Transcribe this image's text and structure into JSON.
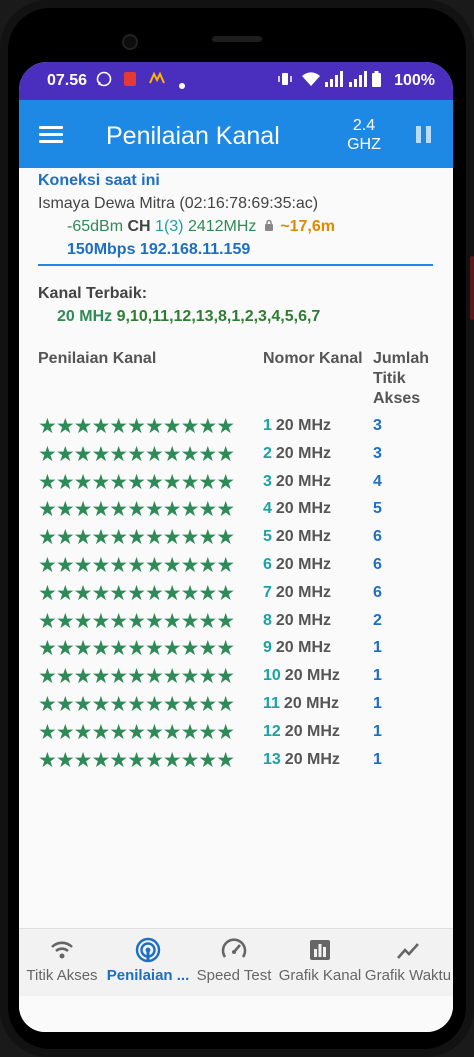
{
  "status_bar": {
    "time": "07.56",
    "battery": "100%"
  },
  "toolbar": {
    "title": "Penilaian Kanal",
    "band_line1": "2.4",
    "band_line2": "GHZ"
  },
  "connection": {
    "header": "Koneksi saat ini",
    "ssid": "Ismaya Dewa Mitra (02:16:78:69:35:ac)",
    "rssi": "-65dBm",
    "ch_label": "CH",
    "channel": "1(3)",
    "frequency": "2412MHz",
    "distance": "~17,6m",
    "speed_ip": "150Mbps 192.168.11.159"
  },
  "best": {
    "label": "Kanal Terbaik:",
    "width": "20 MHz",
    "channels": "9,10,11,12,13,8,1,2,3,4,5,6,7"
  },
  "table": {
    "col_rating": "Penilaian Kanal",
    "col_channel": "Nomor Kanal",
    "col_count": "Jumlah Titik Akses",
    "rows": [
      {
        "stars": "★★★★★★★★★★★",
        "channel": "1",
        "width": "20 MHz",
        "count": "3"
      },
      {
        "stars": "★★★★★★★★★★★",
        "channel": "2",
        "width": "20 MHz",
        "count": "3"
      },
      {
        "stars": "★★★★★★★★★★★",
        "channel": "3",
        "width": "20 MHz",
        "count": "4"
      },
      {
        "stars": "★★★★★★★★★★★",
        "channel": "4",
        "width": "20 MHz",
        "count": "5"
      },
      {
        "stars": "★★★★★★★★★★★",
        "channel": "5",
        "width": "20 MHz",
        "count": "6"
      },
      {
        "stars": "★★★★★★★★★★★",
        "channel": "6",
        "width": "20 MHz",
        "count": "6"
      },
      {
        "stars": "★★★★★★★★★★★",
        "channel": "7",
        "width": "20 MHz",
        "count": "6"
      },
      {
        "stars": "★★★★★★★★★★★",
        "channel": "8",
        "width": "20 MHz",
        "count": "2"
      },
      {
        "stars": "★★★★★★★★★★★",
        "channel": "9",
        "width": "20 MHz",
        "count": "1"
      },
      {
        "stars": "★★★★★★★★★★★",
        "channel": "10",
        "width": "20 MHz",
        "count": "1"
      },
      {
        "stars": "★★★★★★★★★★★",
        "channel": "11",
        "width": "20 MHz",
        "count": "1"
      },
      {
        "stars": "★★★★★★★★★★★",
        "channel": "12",
        "width": "20 MHz",
        "count": "1"
      },
      {
        "stars": "★★★★★★★★★★★",
        "channel": "13",
        "width": "20 MHz",
        "count": "1"
      }
    ]
  },
  "bottom_nav": [
    {
      "label": "Titik Akses",
      "icon": "wifi-icon"
    },
    {
      "label": "Penilaian ...",
      "icon": "radar-icon"
    },
    {
      "label": "Speed Test",
      "icon": "speedometer-icon"
    },
    {
      "label": "Grafik Kanal",
      "icon": "bar-chart-icon"
    },
    {
      "label": "Grafik Waktu",
      "icon": "line-chart-icon"
    }
  ],
  "colors": {
    "accent": "#1e88e5",
    "status_bar": "#4a2fbf",
    "star": "#2e8b57",
    "channel": "#1aa3a3",
    "distance": "#e08a00"
  }
}
